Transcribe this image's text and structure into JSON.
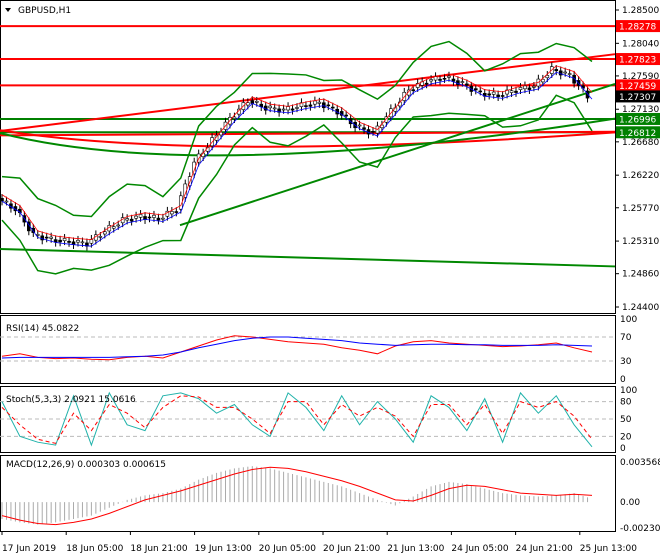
{
  "symbol_title": "GBPUSD,H1",
  "chart_data": {
    "type": "line",
    "title": "GBPUSD,H1",
    "price_axis": {
      "min": 1.244,
      "max": 1.285,
      "ticks": [
        "1.28500",
        "1.28040",
        "1.27590",
        "1.27130",
        "1.26680",
        "1.26220",
        "1.25770",
        "1.25310",
        "1.24860",
        "1.24400"
      ]
    },
    "price_labels": [
      {
        "value": 1.28278,
        "text": "1.28278",
        "color": "#ff0000"
      },
      {
        "value": 1.27823,
        "text": "1.27823",
        "color": "#ff0000"
      },
      {
        "value": 1.27459,
        "text": "1.27459",
        "color": "#ff0000"
      },
      {
        "value": 1.27307,
        "text": "1.27307",
        "color": "#000000"
      },
      {
        "value": 1.26996,
        "text": "1.26996",
        "color": "#008000"
      },
      {
        "value": 1.26812,
        "text": "1.26812",
        "color": "#008000"
      }
    ],
    "close_keypoints": [
      1.259,
      1.2575,
      1.254,
      1.2533,
      1.253,
      1.2528,
      1.2545,
      1.256,
      1.2565,
      1.2562,
      1.2575,
      1.264,
      1.267,
      1.27,
      1.2725,
      1.2715,
      1.2712,
      1.2718,
      1.2722,
      1.271,
      1.269,
      1.268,
      1.271,
      1.274,
      1.2752,
      1.2757,
      1.2748,
      1.2735,
      1.2732,
      1.274,
      1.2745,
      1.2768,
      1.276,
      1.2731
    ],
    "x_labels": [
      "17 Jun 2019",
      "18 Jun 05:00",
      "18 Jun 21:00",
      "19 Jun 13:00",
      "20 Jun 05:00",
      "20 Jun 21:00",
      "21 Jun 13:00",
      "24 Jun 05:00",
      "24 Jun 21:00",
      "25 Jun 13:00"
    ],
    "rsi": {
      "label": "RSI(14) 45.0822",
      "ticks": [
        "100",
        "70",
        "30",
        "0"
      ],
      "levels": [
        70,
        30
      ],
      "values": [
        38,
        42,
        36,
        34,
        35,
        33,
        32,
        36,
        38,
        35,
        45,
        55,
        65,
        72,
        70,
        66,
        62,
        60,
        58,
        52,
        48,
        42,
        55,
        62,
        64,
        60,
        58,
        56,
        54,
        55,
        57,
        60,
        52,
        45
      ],
      "signal": [
        35,
        36,
        36,
        36,
        36,
        36,
        36,
        37,
        38,
        40,
        45,
        52,
        58,
        64,
        68,
        70,
        70,
        68,
        66,
        64,
        60,
        58,
        56,
        57,
        58,
        58,
        57,
        57,
        56,
        56,
        56,
        57,
        56,
        55
      ]
    },
    "stoch": {
      "label": "Stoch(5,3,3) 2.0921 15.0616",
      "ticks": [
        "100",
        "80",
        "50",
        "20",
        "0"
      ],
      "levels": [
        80,
        50,
        20
      ],
      "main": [
        80,
        20,
        10,
        5,
        90,
        5,
        95,
        40,
        30,
        90,
        95,
        85,
        60,
        75,
        40,
        20,
        95,
        70,
        30,
        90,
        40,
        80,
        50,
        10,
        90,
        70,
        30,
        85,
        10,
        95,
        60,
        90,
        40,
        2
      ],
      "signal": [
        70,
        40,
        15,
        8,
        60,
        30,
        75,
        60,
        35,
        70,
        90,
        88,
        70,
        70,
        50,
        25,
        80,
        80,
        40,
        75,
        55,
        70,
        55,
        20,
        75,
        75,
        40,
        75,
        25,
        80,
        70,
        80,
        55,
        15
      ]
    },
    "macd": {
      "label": "MACD(12,26,9) 0.000303 0.000615",
      "ticks": [
        "0.003568",
        "0.00",
        "-0.002302"
      ],
      "min": -0.002302,
      "max": 0.003568,
      "hist": [
        -0.0015,
        -0.0018,
        -0.002,
        -0.0018,
        -0.0015,
        -0.0012,
        -0.0005,
        0.0002,
        0.0006,
        0.0008,
        0.0012,
        0.002,
        0.0026,
        0.003,
        0.0032,
        0.003,
        0.0026,
        0.0022,
        0.0018,
        0.0014,
        0.0008,
        0.0002,
        -0.0003,
        0.0005,
        0.0014,
        0.0018,
        0.0016,
        0.0012,
        0.0008,
        0.0006,
        0.0005,
        0.0006,
        0.0008,
        0.0003
      ],
      "signal": [
        -0.0012,
        -0.0016,
        -0.0019,
        -0.002,
        -0.0018,
        -0.0015,
        -0.001,
        -0.0004,
        0.0002,
        0.0006,
        0.001,
        0.0015,
        0.002,
        0.0025,
        0.0029,
        0.0031,
        0.003,
        0.0027,
        0.0023,
        0.0019,
        0.0014,
        0.0008,
        0.0002,
        0.0001,
        0.0006,
        0.0012,
        0.0015,
        0.0014,
        0.0011,
        0.0008,
        0.0007,
        0.0006,
        0.0007,
        0.0006
      ]
    }
  }
}
